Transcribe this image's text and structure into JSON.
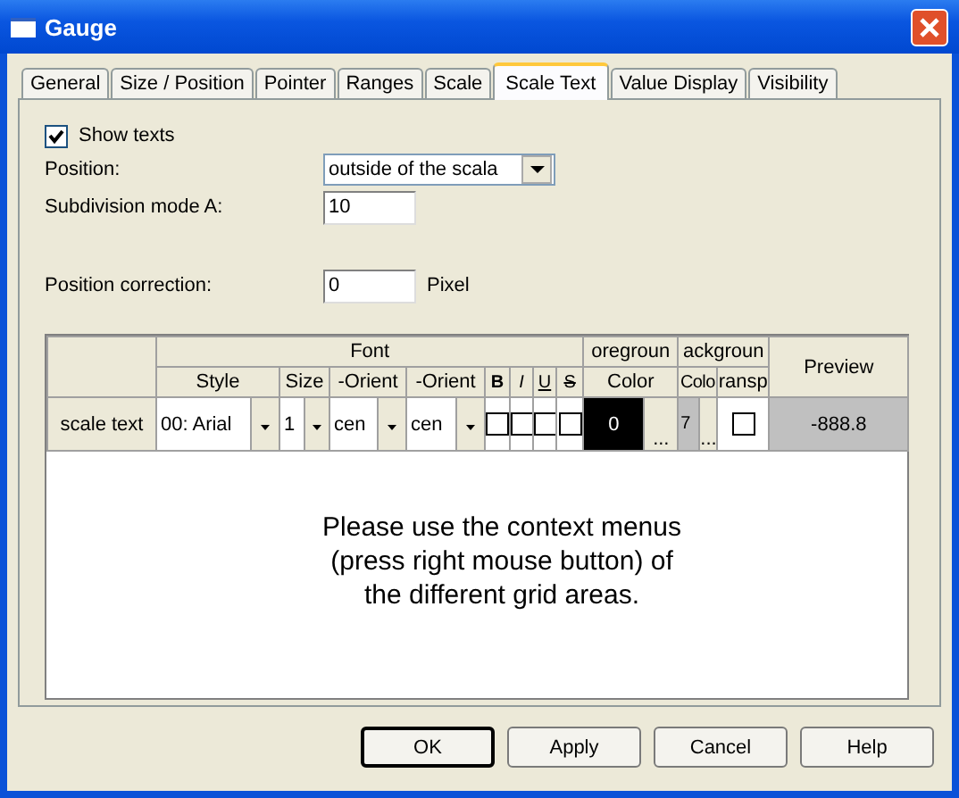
{
  "window": {
    "title": "Gauge"
  },
  "tabs": [
    {
      "label": "General",
      "selected": false
    },
    {
      "label": "Size / Position",
      "selected": false
    },
    {
      "label": "Pointer",
      "selected": false
    },
    {
      "label": "Ranges",
      "selected": false
    },
    {
      "label": "Scale",
      "selected": false
    },
    {
      "label": "Scale Text",
      "selected": true
    },
    {
      "label": "Value Display",
      "selected": false
    },
    {
      "label": "Visibility",
      "selected": false
    }
  ],
  "show_texts": {
    "label": "Show texts",
    "checked": true
  },
  "position": {
    "label": "Position:",
    "value": "outside of the scala"
  },
  "subdivision": {
    "label": "Subdivision mode A:",
    "value": "10"
  },
  "position_correction": {
    "label": "Position correction:",
    "value": "0",
    "unit": "Pixel"
  },
  "grid": {
    "group_font": "Font",
    "group_foreground": "oregroun",
    "group_background": "ackgroun",
    "preview_header": "Preview",
    "headers": [
      "Style",
      "Size",
      "-Orient",
      "-Orient"
    ],
    "style_headers": [
      {
        "label": "B",
        "kind": "bold"
      },
      {
        "label": "I",
        "kind": "italic"
      },
      {
        "label": "U",
        "kind": "underline"
      },
      {
        "label": "S",
        "kind": "strike"
      }
    ],
    "fg_header": "Color",
    "bg_color_header": "Colo",
    "bg_transp_header": "ransp",
    "row": {
      "label": "scale text",
      "style": "00: Arial",
      "size": "1",
      "h_orient": "cen",
      "v_orient": "cen",
      "styles": [
        {
          "checked": false
        },
        {
          "checked": false
        },
        {
          "checked": false
        },
        {
          "checked": false
        }
      ],
      "fg_value": "0",
      "fg_more": "...",
      "bg_value": "7",
      "bg_more": "...",
      "transparent": false,
      "preview": "-888.8"
    },
    "hint": "Please use the context menus (press right mouse button) of the different grid areas."
  },
  "buttons": [
    {
      "label": "OK",
      "default": true
    },
    {
      "label": "Apply",
      "default": false
    },
    {
      "label": "Cancel",
      "default": false
    },
    {
      "label": "Help",
      "default": false
    }
  ]
}
